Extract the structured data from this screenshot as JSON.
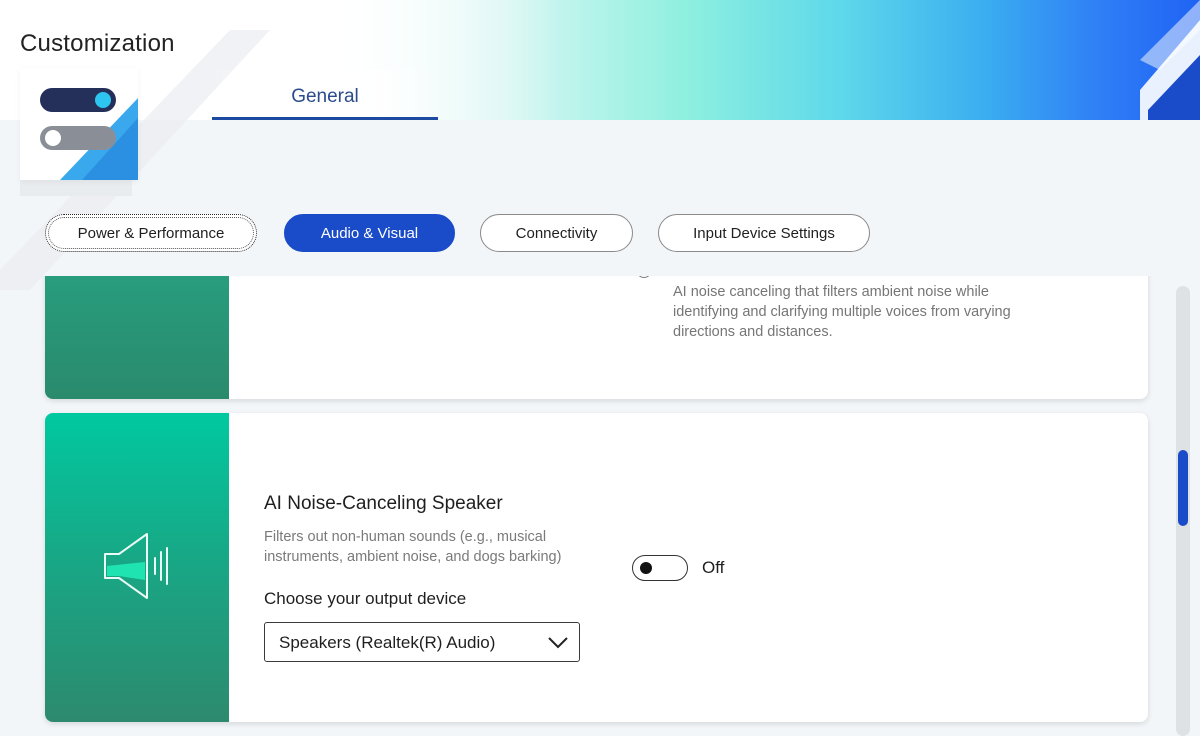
{
  "header": {
    "title": "Customization",
    "tabs": [
      {
        "label": "General",
        "active": true
      }
    ]
  },
  "categories": [
    {
      "label": "Power & Performance",
      "state": "focused"
    },
    {
      "label": "Audio & Visual",
      "state": "active"
    },
    {
      "label": "Connectivity",
      "state": "default"
    },
    {
      "label": "Input Device Settings",
      "state": "default"
    }
  ],
  "cards": {
    "previous": {
      "description": "AI noise canceling that filters ambient noise while identifying and clarifying multiple voices from varying directions and distances."
    },
    "speaker": {
      "icon": "speaker-icon",
      "title": "AI Noise-Canceling Speaker",
      "description": "Filters out non-human sounds (e.g., musical instruments, ambient noise, and dogs barking)",
      "output_label": "Choose your output device",
      "output_device": "Speakers (Realtek(R) Audio)",
      "toggle_state": "Off"
    }
  },
  "colors": {
    "accent": "#1a4bc8",
    "card_side_top": "#00c9a0",
    "card_side_bottom": "#2d8a6e"
  }
}
